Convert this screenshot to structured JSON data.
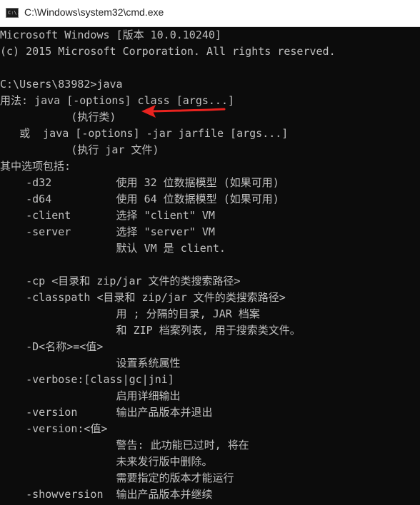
{
  "window": {
    "title": "C:\\Windows\\system32\\cmd.exe",
    "icon": "cmd-console-icon",
    "icon_glyph": "C:\\."
  },
  "console": {
    "lines": [
      "Microsoft Windows [版本 10.0.10240]",
      "(c) 2015 Microsoft Corporation. All rights reserved.",
      "",
      "C:\\Users\\83982>java",
      "用法: java [-options] class [args...]",
      "           (执行类)",
      "   或  java [-options] -jar jarfile [args...]",
      "           (执行 jar 文件)",
      "其中选项包括:",
      "    -d32          使用 32 位数据模型 (如果可用)",
      "    -d64          使用 64 位数据模型 (如果可用)",
      "    -client       选择 \"client\" VM",
      "    -server       选择 \"server\" VM",
      "                  默认 VM 是 client.",
      "",
      "    -cp <目录和 zip/jar 文件的类搜索路径>",
      "    -classpath <目录和 zip/jar 文件的类搜索路径>",
      "                  用 ; 分隔的目录, JAR 档案",
      "                  和 ZIP 档案列表, 用于搜索类文件。",
      "    -D<名称>=<值>",
      "                  设置系统属性",
      "    -verbose:[class|gc|jni]",
      "                  启用详细输出",
      "    -version      输出产品版本并退出",
      "    -version:<值>",
      "                  警告: 此功能已过时, 将在",
      "                  未来发行版中删除。",
      "                  需要指定的版本才能运行",
      "    -showversion  输出产品版本并继续"
    ]
  },
  "annotation": {
    "icon": "red-arrow-icon",
    "color": "#e8231f"
  },
  "colors": {
    "console_bg": "#0c0c0c",
    "console_fg": "#c0c0c0",
    "titlebar_bg": "#ffffff"
  }
}
